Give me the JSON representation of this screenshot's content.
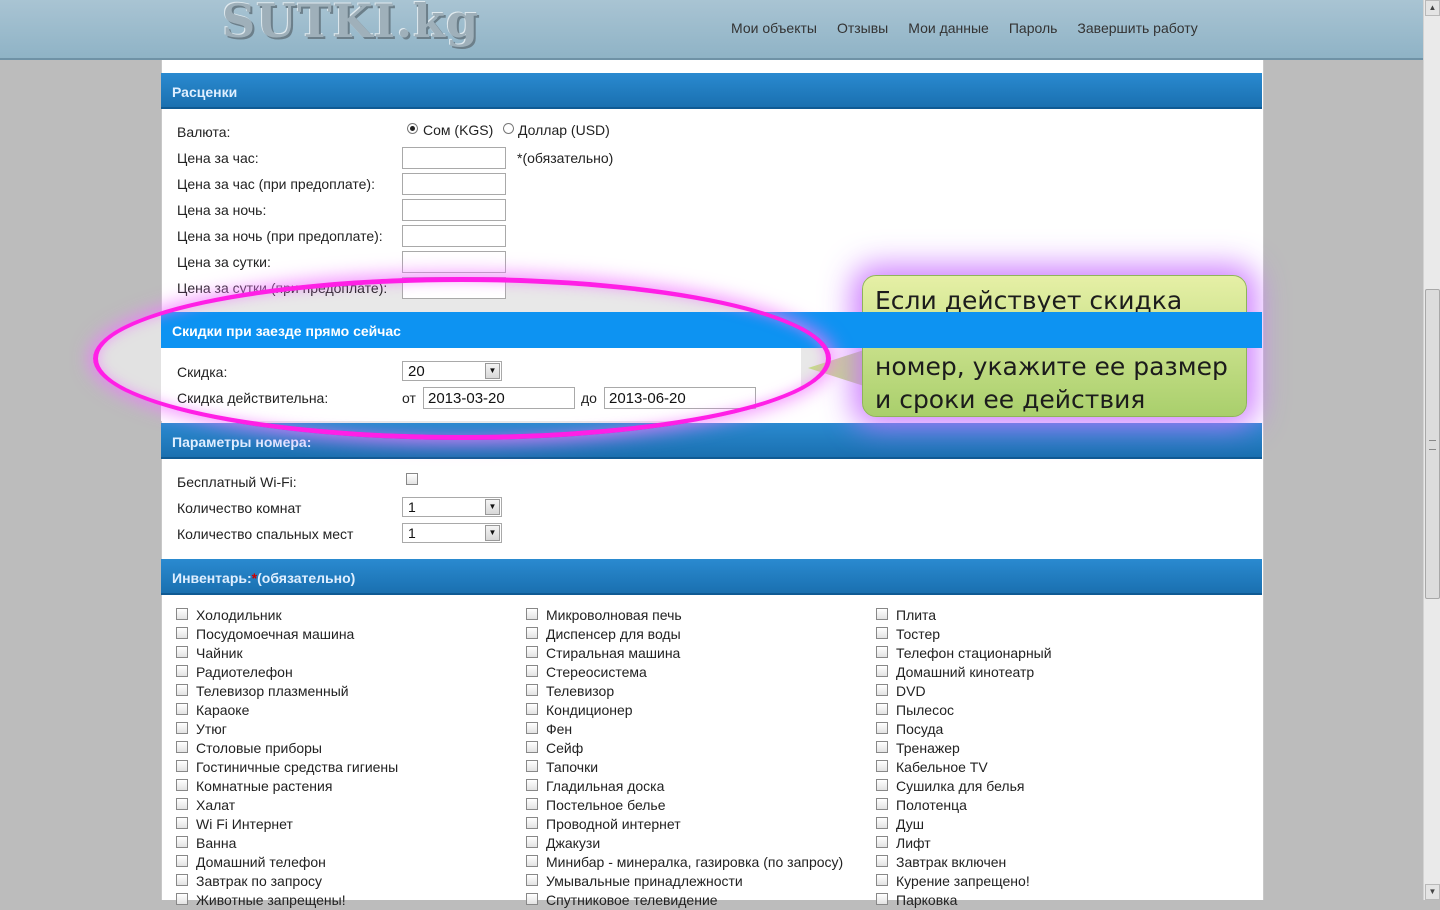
{
  "header": {
    "logo": "SUTKI.kg",
    "nav": [
      "Мои объекты",
      "Отзывы",
      "Мои данные",
      "Пароль",
      "Завершить работу"
    ]
  },
  "pricing": {
    "title": "Расценки",
    "currency_label": "Валюта:",
    "currency_options": [
      "Сом (KGS)",
      "Доллар (USD)"
    ],
    "currency_selected": "Сом (KGS)",
    "price_fields": [
      "Цена за час:",
      "Цена за час (при предоплате):",
      "Цена за ночь:",
      "Цена за ночь (при предоплате):",
      "Цена за сутки:",
      "Цена за сутки (при предоплате):"
    ],
    "required_note": "*(обязательно)"
  },
  "discount": {
    "title": "Скидки при заезде прямо сейчас",
    "discount_label": "Скидка:",
    "discount_value": "20",
    "valid_label": "Скидка действительна:",
    "from_label": "от",
    "from_value": "2013-03-20",
    "to_label": "до",
    "to_value": "2013-06-20"
  },
  "room_params": {
    "title": "Параметры номера:",
    "wifi_label": "Бесплатный Wi-Fi:",
    "rooms_label": "Количество комнат",
    "rooms_value": "1",
    "beds_label": "Количество спальных мест",
    "beds_value": "1"
  },
  "inventory": {
    "title": "Инвентарь:",
    "title_star": "*",
    "title_note": "(обязательно)",
    "col1": [
      "Холодильник",
      "Посудомоечная машина",
      "Чайник",
      "Радиотелефон",
      "Телевизор плазменный",
      "Караоке",
      "Утюг",
      "Столовые приборы",
      "Гостиничные средства гигиены",
      "Комнатные растения",
      "Халат",
      "Wi Fi Интернет",
      "Ванна",
      "Домашний телефон",
      "Завтрак по запросу",
      "Животные запрещены!"
    ],
    "col2": [
      "Микроволновая печь",
      "Диспенсер для воды",
      "Стиральная машина",
      "Стереосистема",
      "Телевизор",
      "Кондиционер",
      "Фен",
      "Сейф",
      "Тапочки",
      "Гладильная доска",
      "Постельное белье",
      "Проводной интернет",
      "Джакузи",
      "Минибар - минералка, газировка (по запросу)",
      "Умывальные принадлежности",
      "Спутниковое телевидение"
    ],
    "col3": [
      "Плита",
      "Тостер",
      "Телефон стационарный",
      "Домашний кинотеатр",
      "DVD",
      "Пылесос",
      "Посуда",
      "Тренажер",
      "Кабельное TV",
      "Сушилка для белья",
      "Полотенца",
      "Душ",
      "Лифт",
      "Завтрак включен",
      "Курение запрещено!",
      "Парковка"
    ]
  },
  "callout": {
    "text": "Если действует скидка при мгновенном заезде в номер, укажите ее размер и сроки ее действия"
  },
  "colors": {
    "section_header": "#1a70b0",
    "highlight_header": "#0d93f2",
    "ellipse_border": "#ff1fe6",
    "callout_bg": "#c4de86"
  }
}
